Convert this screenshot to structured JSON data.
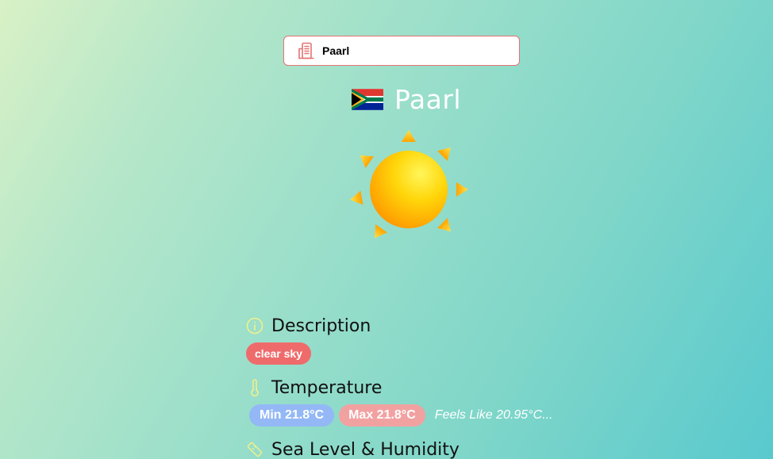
{
  "search": {
    "value": "Paarl",
    "icon": "building-icon"
  },
  "city": {
    "name": "Paarl",
    "flag_icon": "south-africa-flag-icon"
  },
  "weather": {
    "icon": "sun-icon"
  },
  "description": {
    "title": "Description",
    "icon": "info-icon",
    "value": "clear sky"
  },
  "temperature": {
    "title": "Temperature",
    "icon": "thermometer-icon",
    "min": "Min 21.8°C",
    "max": "Max 21.8°C",
    "feels_like": "Feels Like 20.95°C..."
  },
  "sea_level": {
    "title": "Sea Level & Humidity",
    "icon": "ruler-icon"
  },
  "colors": {
    "accent_red": "#ef6b6b",
    "min_blue": "#93b8f5",
    "max_pink": "#f2a1a1",
    "icon_yellow": "#f3f08a"
  }
}
